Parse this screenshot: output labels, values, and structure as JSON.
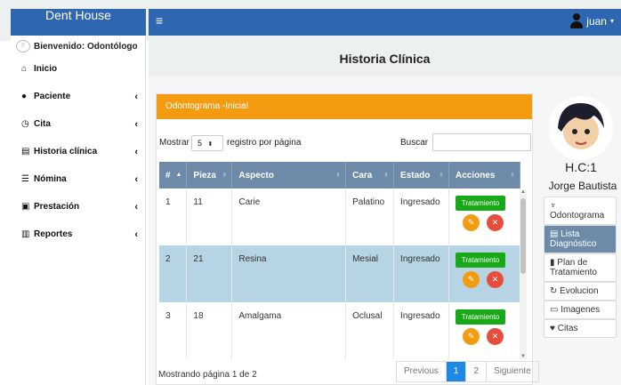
{
  "brand": "Dent House",
  "user": "juan",
  "welcome": "Bienvenido: Odontólogo",
  "menu": [
    {
      "label": "Inicio",
      "icon": "home-icon",
      "glyph": "⌂",
      "arrow": ""
    },
    {
      "label": "Paciente",
      "icon": "user-icon",
      "glyph": "●",
      "arrow": "‹"
    },
    {
      "label": "Cita",
      "icon": "clock-icon",
      "glyph": "◷",
      "arrow": "‹"
    },
    {
      "label": "Historia clínica",
      "icon": "id-card-icon",
      "glyph": "▤",
      "arrow": "‹"
    },
    {
      "label": "Nómina",
      "icon": "list-icon",
      "glyph": "☰",
      "arrow": "‹"
    },
    {
      "label": "Prestación",
      "icon": "medkit-icon",
      "glyph": "▣",
      "arrow": "‹"
    },
    {
      "label": "Reportes",
      "icon": "report-icon",
      "glyph": "▥",
      "arrow": "‹"
    }
  ],
  "page_title": "Historia Clínica",
  "card_title": "Odontograma -Inicial",
  "controls": {
    "show_label": "Mostrar",
    "page_size": "5",
    "per_page_label": "registro por página",
    "search_label": "Buscar",
    "search_value": ""
  },
  "table": {
    "headers": [
      "#",
      "Pieza",
      "Aspecto",
      "Cara",
      "Estado",
      "Acciones"
    ],
    "rows": [
      {
        "num": "1",
        "pieza": "11",
        "aspecto": "Carie",
        "cara": "Palatino",
        "estado": "Ingresado"
      },
      {
        "num": "2",
        "pieza": "21",
        "aspecto": "Resina",
        "cara": "Mesial",
        "estado": "Ingresado"
      },
      {
        "num": "3",
        "pieza": "18",
        "aspecto": "Amalgama",
        "cara": "Oclusal",
        "estado": "Ingresado"
      }
    ],
    "action_label": "Tratamiento"
  },
  "footer_info": "Mostrando página 1 de 2",
  "pager": {
    "previous": "Previous",
    "pages": [
      "1",
      "2"
    ],
    "next": "Siguiente"
  },
  "patient": {
    "hc": "H.C:1",
    "name": "Jorge Bautista"
  },
  "right_menu": [
    {
      "label": "Odontograma",
      "icon": "tooth-icon",
      "glyph": "♆"
    },
    {
      "label": "Lista Diagnóstico",
      "icon": "list-icon",
      "glyph": "▤"
    },
    {
      "label": "Plan de Tratamiento",
      "icon": "clipboard-icon",
      "glyph": "▮"
    },
    {
      "label": "Evolucion",
      "icon": "refresh-icon",
      "glyph": "↻"
    },
    {
      "label": "Imagenes",
      "icon": "image-icon",
      "glyph": "▭"
    },
    {
      "label": "Citas",
      "icon": "heart-icon",
      "glyph": "♥"
    }
  ],
  "colors": {
    "navbar": "#2e66b0",
    "card_header": "#f39c12",
    "table_header": "#6d8aa8",
    "selected_row": "#b6d4e3",
    "treat_button": "#18a818"
  }
}
